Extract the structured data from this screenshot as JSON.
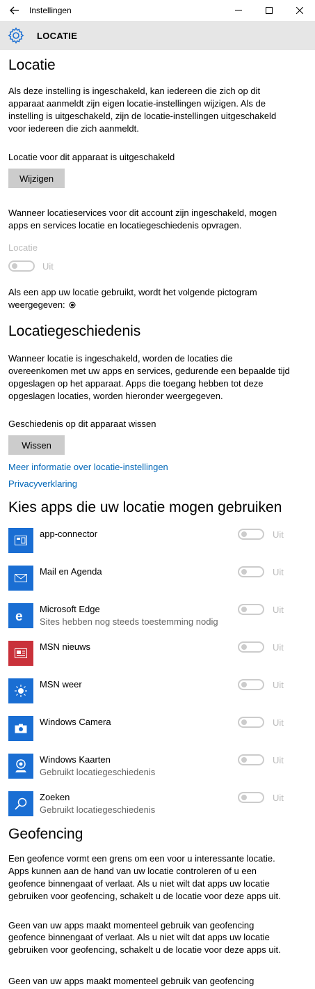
{
  "window": {
    "title": "Instellingen"
  },
  "header": {
    "title": "LOCATIE"
  },
  "location": {
    "heading": "Locatie",
    "description": "Als deze instelling is ingeschakeld, kan iedereen die zich op dit apparaat aanmeldt zijn eigen locatie-instellingen wijzigen. Als de instelling is uitgeschakeld, zijn de locatie-instellingen uitgeschakeld voor iedereen die zich aanmeldt.",
    "device_status": "Locatie voor dit apparaat is uitgeschakeld",
    "change_button": "Wijzigen",
    "services_text": "Wanneer locatieservices voor dit account zijn ingeschakeld, mogen apps en services locatie en locatiegeschiedenis opvragen.",
    "toggle_label": "Locatie",
    "toggle_state": "Uit",
    "icon_text": "Als een app uw locatie gebruikt, wordt het volgende pictogram weergegeven:"
  },
  "history": {
    "heading": "Locatiegeschiedenis",
    "description": "Wanneer locatie is ingeschakeld, worden de locaties die overeenkomen met uw apps en services, gedurende een bepaalde tijd opgeslagen op het apparaat. Apps die toegang hebben tot deze opgeslagen locaties, worden hieronder weergegeven.",
    "clear_label": "Geschiedenis op dit apparaat wissen",
    "clear_button": "Wissen",
    "more_info_link": "Meer informatie over locatie-instellingen",
    "privacy_link": "Privacyverklaring"
  },
  "apps": {
    "heading": "Kies apps die uw locatie mogen gebruiken",
    "items": [
      {
        "name": "app-connector",
        "subtitle": "",
        "state": "Uit",
        "icon": "connector-icon",
        "color": "#1a6ed3"
      },
      {
        "name": "Mail en Agenda",
        "subtitle": "",
        "state": "Uit",
        "icon": "mail-icon",
        "color": "#1a6ed3"
      },
      {
        "name": "Microsoft Edge",
        "subtitle": "Sites hebben nog steeds toestemming nodig",
        "state": "Uit",
        "icon": "edge-icon",
        "color": "#1a6ed3"
      },
      {
        "name": "MSN nieuws",
        "subtitle": "",
        "state": "Uit",
        "icon": "news-icon",
        "color": "#c9313a"
      },
      {
        "name": "MSN weer",
        "subtitle": "",
        "state": "Uit",
        "icon": "weather-icon",
        "color": "#1a6ed3"
      },
      {
        "name": "Windows Camera",
        "subtitle": "",
        "state": "Uit",
        "icon": "camera-icon",
        "color": "#1a6ed3"
      },
      {
        "name": "Windows Kaarten",
        "subtitle": "Gebruikt locatiegeschiedenis",
        "state": "Uit",
        "icon": "maps-icon",
        "color": "#1a6ed3"
      },
      {
        "name": "Zoeken",
        "subtitle": "Gebruikt locatiegeschiedenis",
        "state": "Uit",
        "icon": "search-icon",
        "color": "#1a6ed3"
      }
    ]
  },
  "geofencing": {
    "heading": "Geofencing",
    "description": "Een geofence vormt een grens om een voor u interessante locatie. Apps kunnen aan de hand van uw locatie controleren of u een geofence binnengaat of verlaat. Als u niet wilt dat apps uw locatie gebruiken voor geofencing, schakelt u de locatie voor deze apps uit.",
    "status": "Geen van uw apps maakt momenteel gebruik van geofencing",
    "ghost_text": "geofence binnengaat of verlaat. Als u niet wilt dat apps uw locatie gebruiken voor geofencing, schakelt u de locatie voor deze apps uit.",
    "ghost_status": "Geen van uw apps maakt momenteel gebruik van geofencing"
  }
}
